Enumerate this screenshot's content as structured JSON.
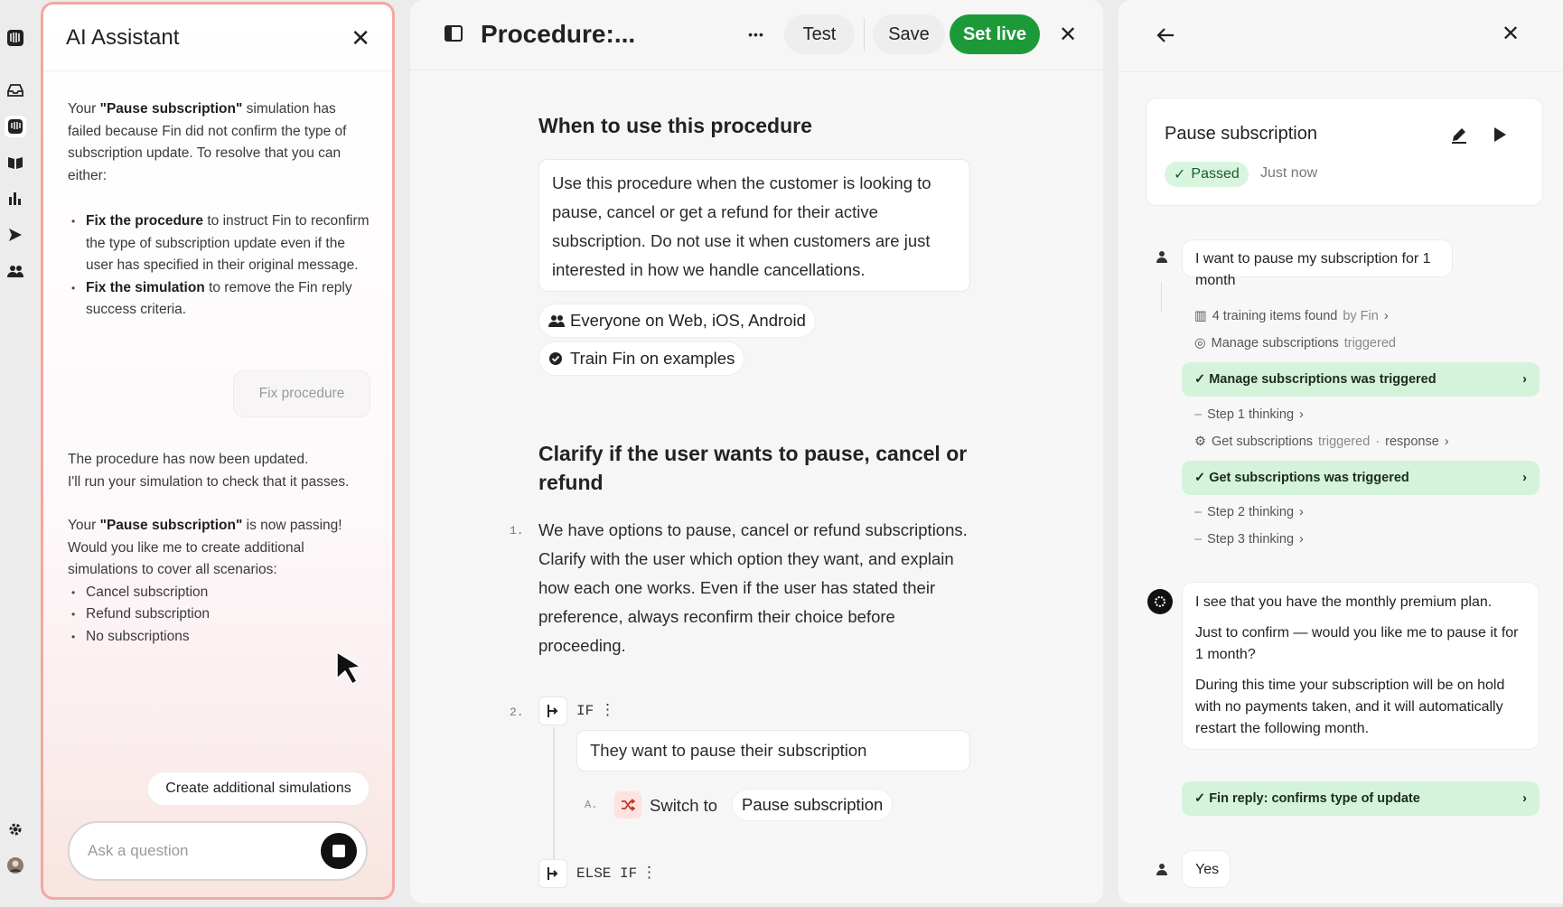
{
  "assistant": {
    "title": "AI Assistant",
    "intro_a": "Your ",
    "intro_b": "\"Pause subscription\"",
    "intro_c": " simulation has failed because Fin did not confirm the type of subscription update. To resolve that you can either:",
    "opt1_bold": "Fix the procedure",
    "opt1_rest": " to instruct Fin to reconfirm the type of subscription update even if the user has specified in their original message.",
    "opt2_bold": "Fix the simulation",
    "opt2_rest": " to remove the  Fin reply success criteria.",
    "fix_button": "Fix procedure",
    "updated_1": "The procedure has now been updated.",
    "updated_2": "I'll run your simulation to check that it passes.",
    "pass_a": "Your ",
    "pass_b": "\"Pause subscription\"",
    "pass_c": " is now passing! Would you like me to create additional simulations to cover all scenarios:",
    "scenarios": [
      "Cancel subscription",
      "Refund subscription",
      "No subscriptions"
    ],
    "create_button": "Create additional simulations",
    "input_placeholder": "Ask a question"
  },
  "procedure": {
    "title": "Procedure:...",
    "more": "•••",
    "test": "Test",
    "save": "Save",
    "set_live": "Set live",
    "when_heading": "When to use this procedure",
    "when_text": "Use this procedure when the customer is looking to pause, cancel or get a refund for their active subscription. Do not use it when customers are just interested in how we handle cancellations.",
    "audience": "Everyone on Web, iOS, Android",
    "train": "Train Fin on examples",
    "clarify_heading": "Clarify if the user wants to pause, cancel or refund",
    "step1_num": "1.",
    "step1_text": "We have options to pause, cancel or refund subscriptions. Clarify with the user which option they want, and explain how each one works. Even if the user has stated their preference, always reconfirm their choice before proceeding.",
    "step2_num": "2.",
    "if_label": "IF",
    "if_condition": "They want to pause their subscription",
    "a_label": "A.",
    "switch_to": "Switch to",
    "switch_target": "Pause subscription",
    "else_if_label": "ELSE IF"
  },
  "simulation": {
    "name": "Pause subscription",
    "status": "Passed",
    "time": "Just now",
    "user_msg": "I want to pause my subscription for 1 month",
    "training_a": "4 training items found",
    "training_b": "by Fin",
    "manage_a": "Manage subscriptions",
    "manage_b": "triggered",
    "manage_check": "Manage subscriptions was triggered",
    "step1": "Step 1 thinking",
    "get_a": "Get subscriptions",
    "get_b": "triggered",
    "get_c": "·",
    "get_d": "response",
    "get_check": "Get subscriptions was triggered",
    "step2": "Step 2 thinking",
    "step3": "Step 3 thinking",
    "fin_p1": "I see that you have the monthly premium plan.",
    "fin_p2": "Just to confirm — would you like me to pause it for 1 month?",
    "fin_p3": "During this time your subscription will be on hold with no payments taken, and it will automatically restart the following month.",
    "fin_check": "Fin reply: confirms type of update",
    "user_reply": "Yes"
  }
}
